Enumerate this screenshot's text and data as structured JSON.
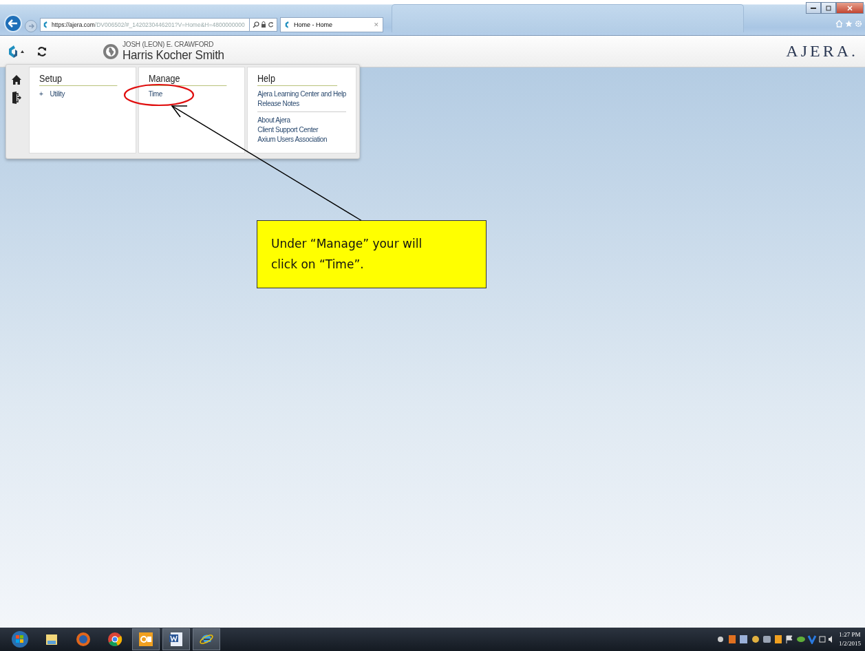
{
  "browser": {
    "url_host": "https://ajera.com",
    "url_path": "/DV006502/#_1420230446201?V=Home&H=4800000000",
    "tab_title": "Home - Home",
    "tab_close": "✕"
  },
  "header": {
    "user": "JOSH (LEON) E. CRAWFORD",
    "company": "Harris Kocher Smith",
    "brand": "AJERA."
  },
  "menu": {
    "columns": [
      {
        "heading": "Setup",
        "groups": [
          [
            {
              "label": "Utility",
              "kind": "expandable",
              "marker": "+"
            }
          ]
        ]
      },
      {
        "heading": "Manage",
        "groups": [
          [
            {
              "label": "Time",
              "kind": "link"
            }
          ]
        ]
      },
      {
        "heading": "Help",
        "groups": [
          [
            {
              "label": "Ajera Learning Center and Help",
              "kind": "link"
            },
            {
              "label": "Release Notes",
              "kind": "link"
            }
          ],
          [
            {
              "label": "About Ajera",
              "kind": "link"
            },
            {
              "label": "Client Support Center",
              "kind": "link"
            },
            {
              "label": "Axium Users Association",
              "kind": "link"
            }
          ]
        ]
      }
    ]
  },
  "callout": {
    "text": "Under “Manage” your will click on “Time”."
  },
  "taskbar": {
    "clock_time": "1:27 PM",
    "clock_date": "1/2/2015"
  }
}
